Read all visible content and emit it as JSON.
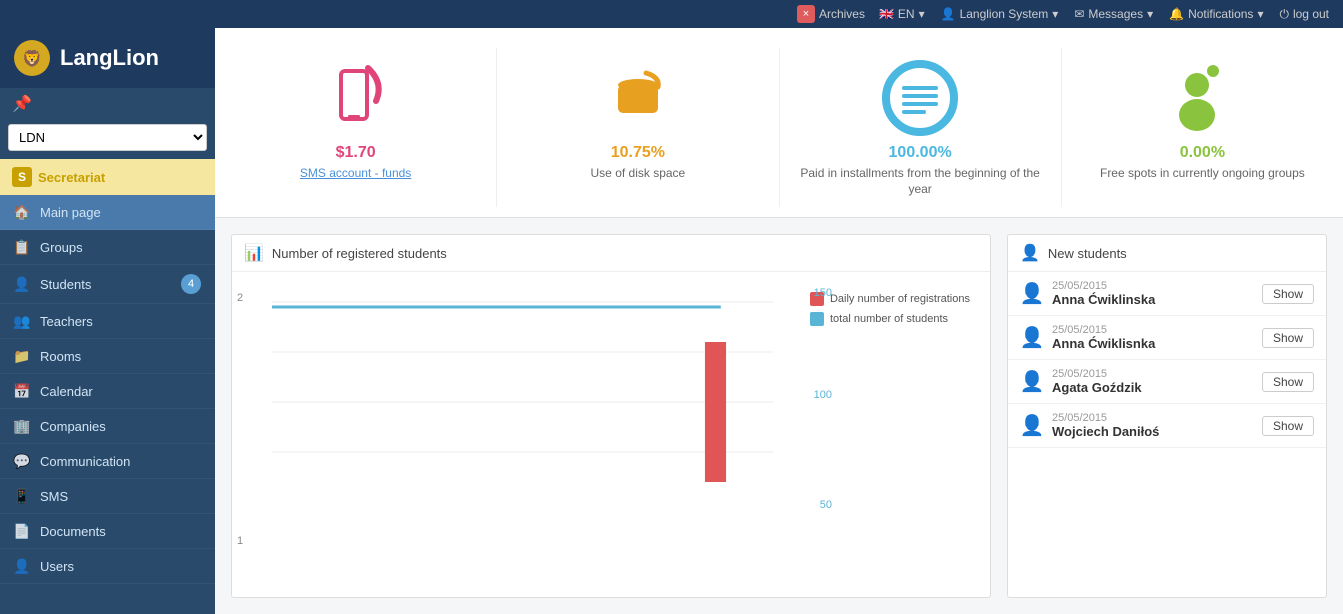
{
  "topbar": {
    "close_label": "×",
    "archives_label": "Archives",
    "lang_label": "EN",
    "user_label": "Langlion System",
    "messages_label": "Messages",
    "notifications_label": "Notifications",
    "logout_label": "log out"
  },
  "sidebar": {
    "logo_text": "LangLion",
    "school_name": "LDN",
    "section": {
      "letter": "S",
      "label": "Secretariat"
    },
    "items": [
      {
        "id": "main-page",
        "label": "Main page",
        "icon": "🏠",
        "active": true
      },
      {
        "id": "groups",
        "label": "Groups",
        "icon": "📋"
      },
      {
        "id": "students",
        "label": "Students",
        "icon": "👤",
        "badge": "4"
      },
      {
        "id": "teachers",
        "label": "Teachers",
        "icon": "👥"
      },
      {
        "id": "rooms",
        "label": "Rooms",
        "icon": "📁"
      },
      {
        "id": "calendar",
        "label": "Calendar",
        "icon": "📅"
      },
      {
        "id": "companies",
        "label": "Companies",
        "icon": "🏢"
      },
      {
        "id": "communication",
        "label": "Communication",
        "icon": "💬"
      },
      {
        "id": "sms",
        "label": "SMS",
        "icon": "📱"
      },
      {
        "id": "documents",
        "label": "Documents",
        "icon": "📄"
      },
      {
        "id": "users",
        "label": "Users",
        "icon": "👤"
      }
    ]
  },
  "stats": [
    {
      "id": "sms",
      "value": "$1.70",
      "value_color": "#e0457a",
      "label": "SMS account - funds",
      "is_link": true,
      "icon_type": "sms"
    },
    {
      "id": "disk",
      "value": "10.75%",
      "value_color": "#e8a020",
      "label": "Use of disk space",
      "is_link": false,
      "icon_type": "disk"
    },
    {
      "id": "circle",
      "value": "100.00%",
      "value_color": "#4ab8e0",
      "label": "Paid in installments from the beginning of the year",
      "is_link": false,
      "icon_type": "circle"
    },
    {
      "id": "spots",
      "value": "0.00%",
      "value_color": "#8ac43f",
      "label": "Free spots in currently ongoing groups",
      "is_link": false,
      "icon_type": "person"
    }
  ],
  "chart": {
    "title": "Number of registered students",
    "legend": [
      {
        "label": "Daily number of registrations",
        "color": "#e05555"
      },
      {
        "label": "total number of students",
        "color": "#5ab4d6"
      }
    ],
    "y_left_labels": [
      "2",
      "1"
    ],
    "y_right_labels": [
      "150",
      "100",
      "50"
    ]
  },
  "new_students": {
    "title": "New students",
    "entries": [
      {
        "date": "25/05/2015",
        "name": "Anna Ćwiklinska",
        "btn": "Show"
      },
      {
        "date": "25/05/2015",
        "name": "Anna Ćwiklisnka",
        "btn": "Show"
      },
      {
        "date": "25/05/2015",
        "name": "Agata Goździk",
        "btn": "Show"
      },
      {
        "date": "25/05/2015",
        "name": "Wojciech Daniłoś",
        "btn": "Show"
      }
    ]
  }
}
